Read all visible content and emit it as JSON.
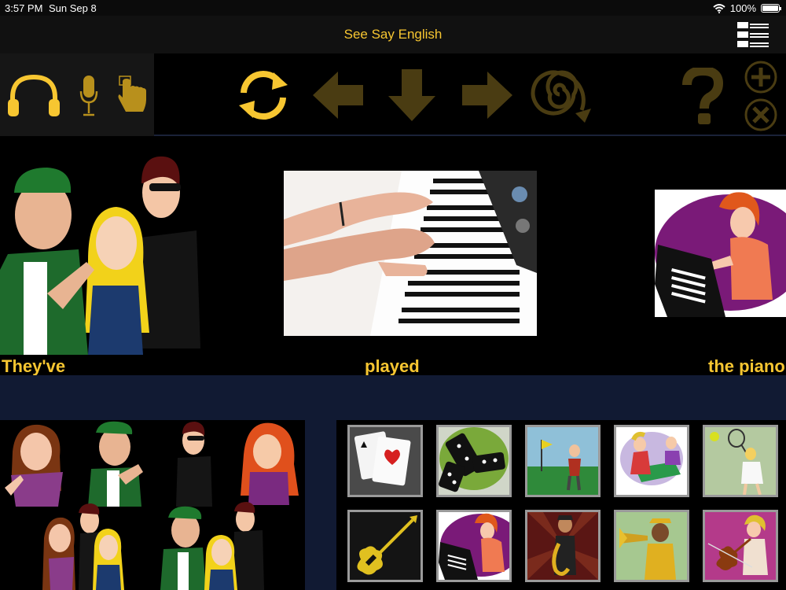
{
  "status": {
    "time": "3:57 PM",
    "date": "Sun Sep 8",
    "battery": "100%",
    "battery_level": 1.0,
    "icons": [
      "wifi-icon",
      "battery-icon"
    ]
  },
  "header": {
    "title": "See Say English"
  },
  "toolbar": {
    "left_tools": [
      "headphones-icon",
      "microphone-icon",
      "pointer-hand-icon"
    ],
    "controls": [
      "refresh-icon",
      "arrow-left-icon",
      "arrow-down-icon",
      "arrow-right-icon",
      "spiral-icon"
    ],
    "right_tools": [
      "help-icon",
      "add-icon",
      "close-icon"
    ],
    "accent": "#f7c631",
    "dim": "#4a3c12"
  },
  "sentence": {
    "words": [
      "They've",
      "played",
      "the piano"
    ]
  },
  "subjects": {
    "items": [
      "girl",
      "boy",
      "man",
      "woman",
      "couple",
      "group"
    ]
  },
  "objects": {
    "items": [
      "cards",
      "dominoes",
      "golf",
      "ping-pong",
      "tennis",
      "guitar",
      "piano",
      "saxophone",
      "trumpet",
      "violin"
    ]
  }
}
